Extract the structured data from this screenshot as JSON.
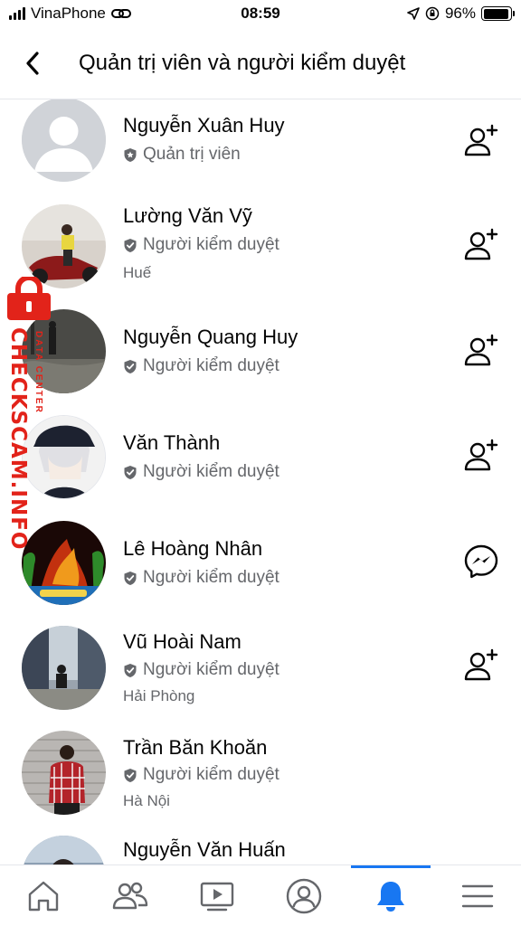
{
  "status_bar": {
    "carrier": "VinaPhone",
    "time": "08:59",
    "battery": "96%",
    "battery_level": 0.96
  },
  "header": {
    "title": "Quản trị viên và người kiểm duyệt",
    "back_icon": "chevron-left-icon"
  },
  "members": [
    {
      "name": "Nguyễn Xuân Huy",
      "role": "Quản trị viên",
      "role_icon": "admin-badge-icon",
      "location": "",
      "action_icon": "add-friend-icon"
    },
    {
      "name": "Lường Văn Vỹ",
      "role": "Người kiểm duyệt",
      "role_icon": "moderator-shield-icon",
      "location": "Huế",
      "action_icon": "add-friend-icon"
    },
    {
      "name": "Nguyễn Quang Huy",
      "role": "Người kiểm duyệt",
      "role_icon": "moderator-shield-icon",
      "location": "",
      "action_icon": "add-friend-icon"
    },
    {
      "name": "Văn Thành",
      "role": "Người kiểm duyệt",
      "role_icon": "moderator-shield-icon",
      "location": "",
      "action_icon": "add-friend-icon"
    },
    {
      "name": "Lê Hoàng Nhân",
      "role": "Người kiểm duyệt",
      "role_icon": "moderator-shield-icon",
      "location": "",
      "action_icon": "messenger-icon"
    },
    {
      "name": "Vũ Hoài Nam",
      "role": "Người kiểm duyệt",
      "role_icon": "moderator-shield-icon",
      "location": "Hải Phòng",
      "action_icon": "add-friend-icon"
    },
    {
      "name": "Trần Băn Khoăn",
      "role": "Người kiểm duyệt",
      "role_icon": "moderator-shield-icon",
      "location": "Hà Nội",
      "action_icon": ""
    },
    {
      "name": "Nguyễn Văn Huấn",
      "role": "",
      "role_icon": "",
      "location": "",
      "action_icon": ""
    }
  ],
  "watermark": {
    "text": "CHECKSCAM.INFO",
    "subtext": "DATA CENTER",
    "color": "#e2231a"
  },
  "bottom_nav": [
    {
      "icon": "home-icon",
      "active": false
    },
    {
      "icon": "friends-icon",
      "active": false
    },
    {
      "icon": "watch-video-icon",
      "active": false
    },
    {
      "icon": "profile-icon",
      "active": false
    },
    {
      "icon": "notifications-bell-icon",
      "active": true
    },
    {
      "icon": "menu-icon",
      "active": false
    }
  ],
  "colors": {
    "accent": "#1877f2",
    "secondary_text": "#65676b",
    "primary_text": "#050505"
  }
}
